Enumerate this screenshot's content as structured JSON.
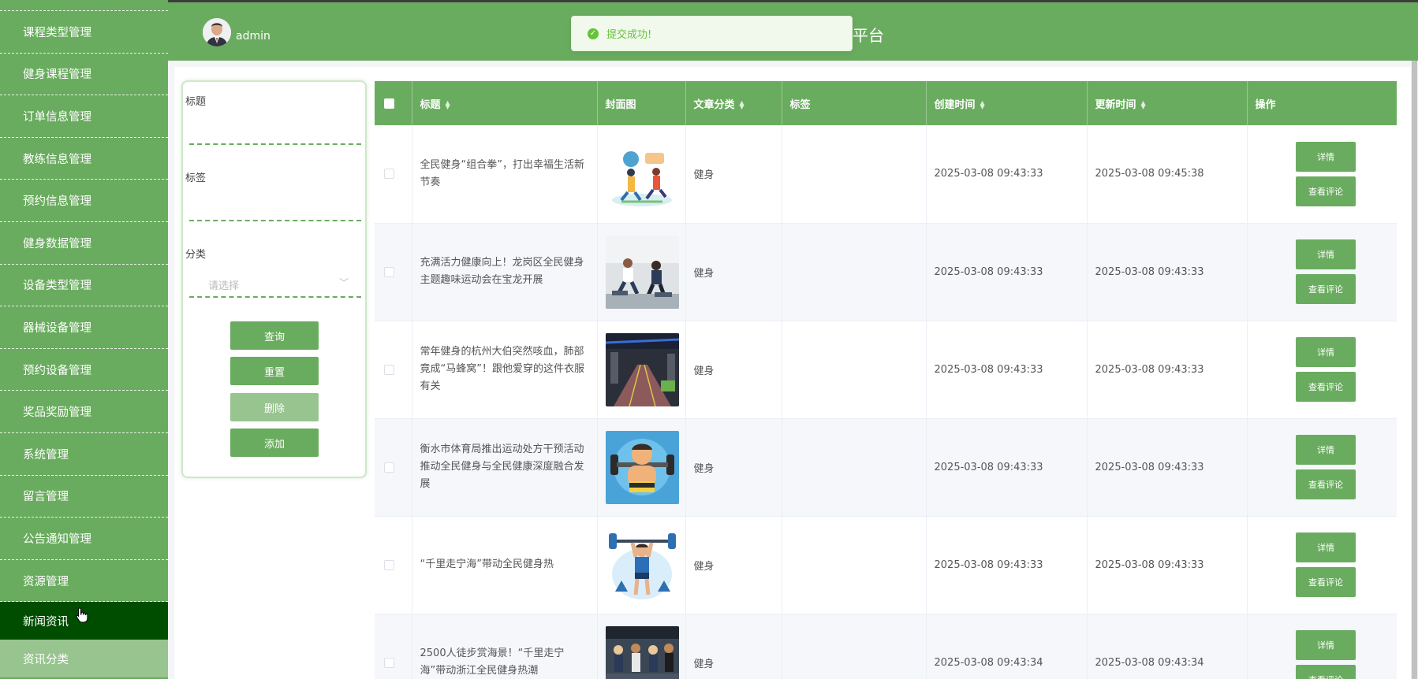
{
  "sidebar": {
    "items": [
      {
        "label": "课程类型管理"
      },
      {
        "label": "健身课程管理"
      },
      {
        "label": "订单信息管理"
      },
      {
        "label": "教练信息管理"
      },
      {
        "label": "预约信息管理"
      },
      {
        "label": "健身数据管理"
      },
      {
        "label": "设备类型管理"
      },
      {
        "label": "器械设备管理"
      },
      {
        "label": "预约设备管理"
      },
      {
        "label": "奖品奖励管理"
      },
      {
        "label": "系统管理"
      },
      {
        "label": "留言管理"
      },
      {
        "label": "公告通知管理"
      },
      {
        "label": "资源管理"
      }
    ],
    "active_item": "新闻资讯",
    "sub_item": "资讯分类"
  },
  "header": {
    "username": "admin",
    "title_visible_fragment": "平台"
  },
  "toast": {
    "message": "提交成功!"
  },
  "search": {
    "title_label": "标题",
    "tag_label": "标签",
    "category_label": "分类",
    "category_placeholder": "请选择",
    "query_button": "查询",
    "reset_button": "重置",
    "delete_button": "删除",
    "add_button": "添加"
  },
  "table": {
    "columns": {
      "title": "标题",
      "cover": "封面图",
      "category": "文章分类",
      "tags": "标签",
      "created": "创建时间",
      "updated": "更新时间",
      "actions": "操作"
    },
    "rows": [
      {
        "title": "全民健身“组合拳”，打出幸福生活新节奏",
        "category": "健身",
        "tags": "",
        "created": "2025-03-08 09:43:33",
        "updated": "2025-03-08 09:45:38",
        "detail": "详情",
        "comments": "查看评论"
      },
      {
        "title": "充满活力健康向上！龙岗区全民健身主题趣味运动会在宝龙开展",
        "category": "健身",
        "tags": "",
        "created": "2025-03-08 09:43:33",
        "updated": "2025-03-08 09:43:33",
        "detail": "详情",
        "comments": "查看评论"
      },
      {
        "title": "常年健身的杭州大伯突然咳血，肺部竟成“马蜂窝”！跟他爱穿的这件衣服有关",
        "category": "健身",
        "tags": "",
        "created": "2025-03-08 09:43:33",
        "updated": "2025-03-08 09:43:33",
        "detail": "详情",
        "comments": "查看评论"
      },
      {
        "title": "衡水市体育局推出运动处方干预活动推动全民健身与全民健康深度融合发展",
        "category": "健身",
        "tags": "",
        "created": "2025-03-08 09:43:33",
        "updated": "2025-03-08 09:43:33",
        "detail": "详情",
        "comments": "查看评论"
      },
      {
        "title": "“千里走宁海”带动全民健身热",
        "category": "健身",
        "tags": "",
        "created": "2025-03-08 09:43:33",
        "updated": "2025-03-08 09:43:33",
        "detail": "详情",
        "comments": "查看评论"
      },
      {
        "title": "2500人徒步赏海景！“千里走宁海”带动浙江全民健身热潮",
        "category": "健身",
        "tags": "",
        "created": "2025-03-08 09:43:34",
        "updated": "2025-03-08 09:43:34",
        "detail": "详情",
        "comments": "查看评论"
      }
    ]
  },
  "colors": {
    "primary": "#6aac5f",
    "active_menu": "#004d00",
    "sub_menu": "#98c48f",
    "toast_green": "#67c23a"
  }
}
